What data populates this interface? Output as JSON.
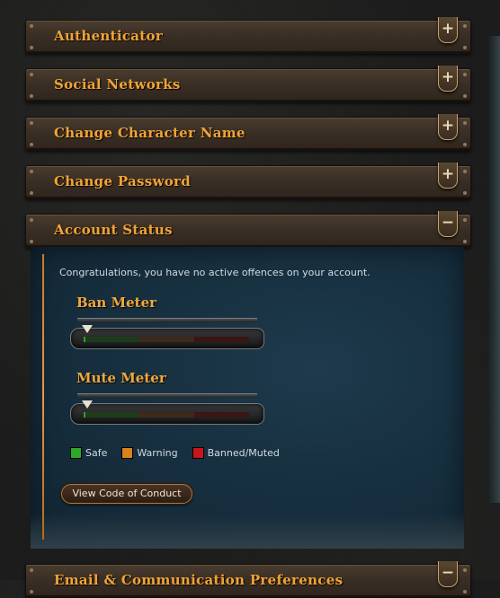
{
  "panels": [
    {
      "title": "Authenticator",
      "toggle": "+"
    },
    {
      "title": "Social Networks",
      "toggle": "+"
    },
    {
      "title": "Change Character Name",
      "toggle": "+"
    },
    {
      "title": "Change Password",
      "toggle": "+"
    },
    {
      "title": "Account Status",
      "toggle": "−"
    },
    {
      "title": "Email & Communication Preferences",
      "toggle": "−"
    }
  ],
  "account_status": {
    "message": "Congratulations, you have no active offences on your account.",
    "ban_meter": {
      "label": "Ban Meter",
      "level": 0.0
    },
    "mute_meter": {
      "label": "Mute Meter",
      "level": 0.0
    },
    "legend": [
      {
        "label": "Safe",
        "color": "#2fa82a"
      },
      {
        "label": "Warning",
        "color": "#d9831c"
      },
      {
        "label": "Banned/Muted",
        "color": "#c8161c"
      }
    ],
    "code_of_conduct_button": "View Code of Conduct"
  },
  "colors": {
    "title_orange": "#f2a335",
    "content_blue": "#173040"
  }
}
